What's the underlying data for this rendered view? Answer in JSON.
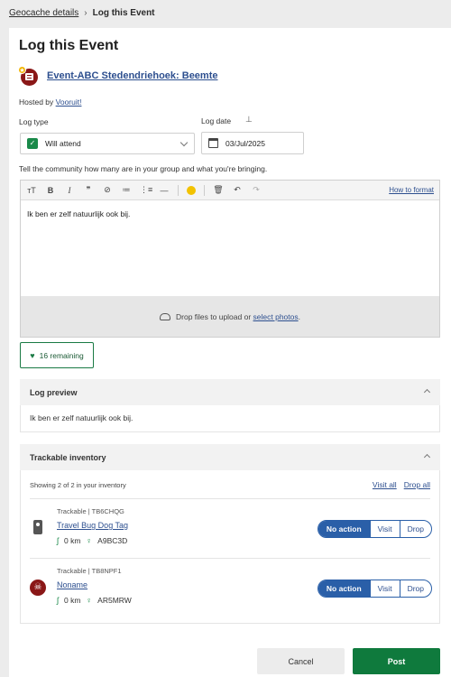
{
  "breadcrumb": {
    "parent": "Geocache details",
    "separator": "›",
    "current": "Log this Event"
  },
  "page": {
    "title": "Log this Event"
  },
  "cache": {
    "name": "Event-ABC Stedendriehoek: Beemte",
    "hosted_prefix": "Hosted by ",
    "host": "Vooruit!"
  },
  "log_type": {
    "label": "Log type",
    "value": "Will attend"
  },
  "log_date": {
    "label": "Log date",
    "value": "03/Jul/2025"
  },
  "prompt": "Tell the community how many are in your group and what you're bringing.",
  "editor": {
    "toolbar": [
      "тT",
      "B",
      "I",
      "❞",
      "⊘",
      "≔",
      "⋮≡",
      "—"
    ],
    "how_to": "How to format",
    "text": "Ik ben er zelf natuurlijk ook bij.",
    "drop_text": "Drop files to upload or ",
    "drop_link": "select photos",
    "drop_end": "."
  },
  "remaining": "16 remaining",
  "preview": {
    "header": "Log preview",
    "text": "Ik ben er zelf natuurlijk ook bij."
  },
  "inventory": {
    "header": "Trackable inventory",
    "showing": "Showing 2 of 2 in your inventory",
    "visit_all": "Visit all",
    "drop_all": "Drop all",
    "items": [
      {
        "code": "Trackable | TB6CHQG",
        "name": "Travel Bug Dog Tag",
        "distance": "0 km",
        "location": "A9BC3D",
        "icon": "dog-tag-icon"
      },
      {
        "code": "Trackable | TB8NPF1",
        "name": "Noname",
        "distance": "0 km",
        "location": "AR5MRW",
        "icon": "skull-icon"
      }
    ],
    "actions": [
      "No action",
      "Visit",
      "Drop"
    ]
  },
  "buttons": {
    "cancel": "Cancel",
    "post": "Post"
  },
  "colors": {
    "accent_blue": "#2a5fa8",
    "post_green": "#0f7a3d",
    "event_red": "#8a1717"
  }
}
